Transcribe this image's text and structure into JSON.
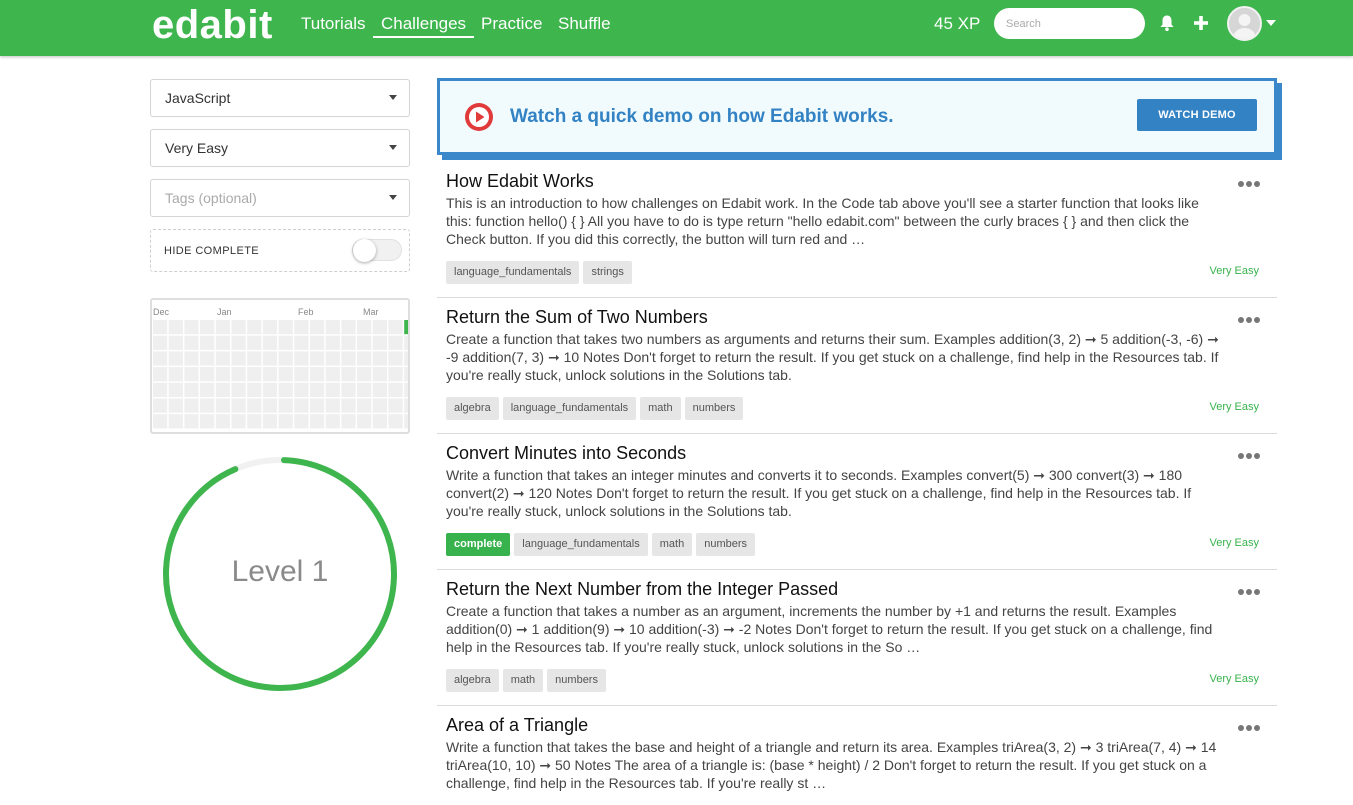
{
  "header": {
    "logo": "edabit",
    "nav": [
      {
        "label": "Tutorials"
      },
      {
        "label": "Challenges"
      },
      {
        "label": "Practice"
      },
      {
        "label": "Shuffle"
      }
    ],
    "xp": "45 XP",
    "search_placeholder": "Search",
    "icons": {
      "bell": "bell-icon",
      "plus": "plus-icon",
      "avatar": "user-avatar",
      "caret": "caret-down-icon"
    }
  },
  "sidebar": {
    "language": "JavaScript",
    "difficulty": "Very Easy",
    "tags_placeholder": "Tags (optional)",
    "hide_complete_label": "HIDE COMPLETE",
    "hide_complete_on": false,
    "heatmap_months": [
      "Dec",
      "Jan",
      "Feb",
      "Mar"
    ],
    "level_text": "Level 1",
    "level_progress": 0.93,
    "accent": "#3eb54d"
  },
  "demo": {
    "text": "Watch a quick demo on how Edabit works.",
    "button": "WATCH DEMO",
    "accent": "#3282c4"
  },
  "challenges": [
    {
      "title": "How Edabit Works",
      "description": "This is an introduction to how challenges on Edabit work. In the Code tab above you'll see a starter function that looks like this: function hello() { } All you have to do is type return \"hello edabit.com\" between the curly braces { } and then click the Check button. If you did this correctly, the button will turn red and …",
      "tags": [
        "language_fundamentals",
        "strings"
      ],
      "difficulty": "Very Easy"
    },
    {
      "title": "Return the Sum of Two Numbers",
      "description": "Create a function that takes two numbers as arguments and returns their sum. Examples addition(3, 2) ➞ 5 addition(-3, -6) ➞ -9 addition(7, 3) ➞ 10 Notes Don't forget to return the result. If you get stuck on a challenge, find help in the Resources tab. If you're really stuck, unlock solutions in the Solutions tab.",
      "tags": [
        "algebra",
        "language_fundamentals",
        "math",
        "numbers"
      ],
      "difficulty": "Very Easy"
    },
    {
      "title": "Convert Minutes into Seconds",
      "description": "Write a function that takes an integer minutes and converts it to seconds. Examples convert(5) ➞ 300 convert(3) ➞ 180 convert(2) ➞ 120 Notes Don't forget to return the result. If you get stuck on a challenge, find help in the Resources tab. If you're really stuck, unlock solutions in the Solutions tab.",
      "tags": [
        "complete",
        "language_fundamentals",
        "math",
        "numbers"
      ],
      "difficulty": "Very Easy"
    },
    {
      "title": "Return the Next Number from the Integer Passed",
      "description": "Create a function that takes a number as an argument, increments the number by +1 and returns the result. Examples addition(0) ➞ 1 addition(9) ➞ 10 addition(-3) ➞ -2 Notes Don't forget to return the result. If you get stuck on a challenge, find help in the Resources tab. If you're really stuck, unlock solutions in the So …",
      "tags": [
        "algebra",
        "math",
        "numbers"
      ],
      "difficulty": "Very Easy"
    },
    {
      "title": "Area of a Triangle",
      "description": "Write a function that takes the base and height of a triangle and return its area. Examples triArea(3, 2) ➞ 3 triArea(7, 4) ➞ 14 triArea(10, 10) ➞ 50 Notes The area of a triangle is: (base * height) / 2 Don't forget to return the result. If you get stuck on a challenge, find help in the Resources tab. If you're really st …",
      "tags": [],
      "difficulty": ""
    }
  ]
}
